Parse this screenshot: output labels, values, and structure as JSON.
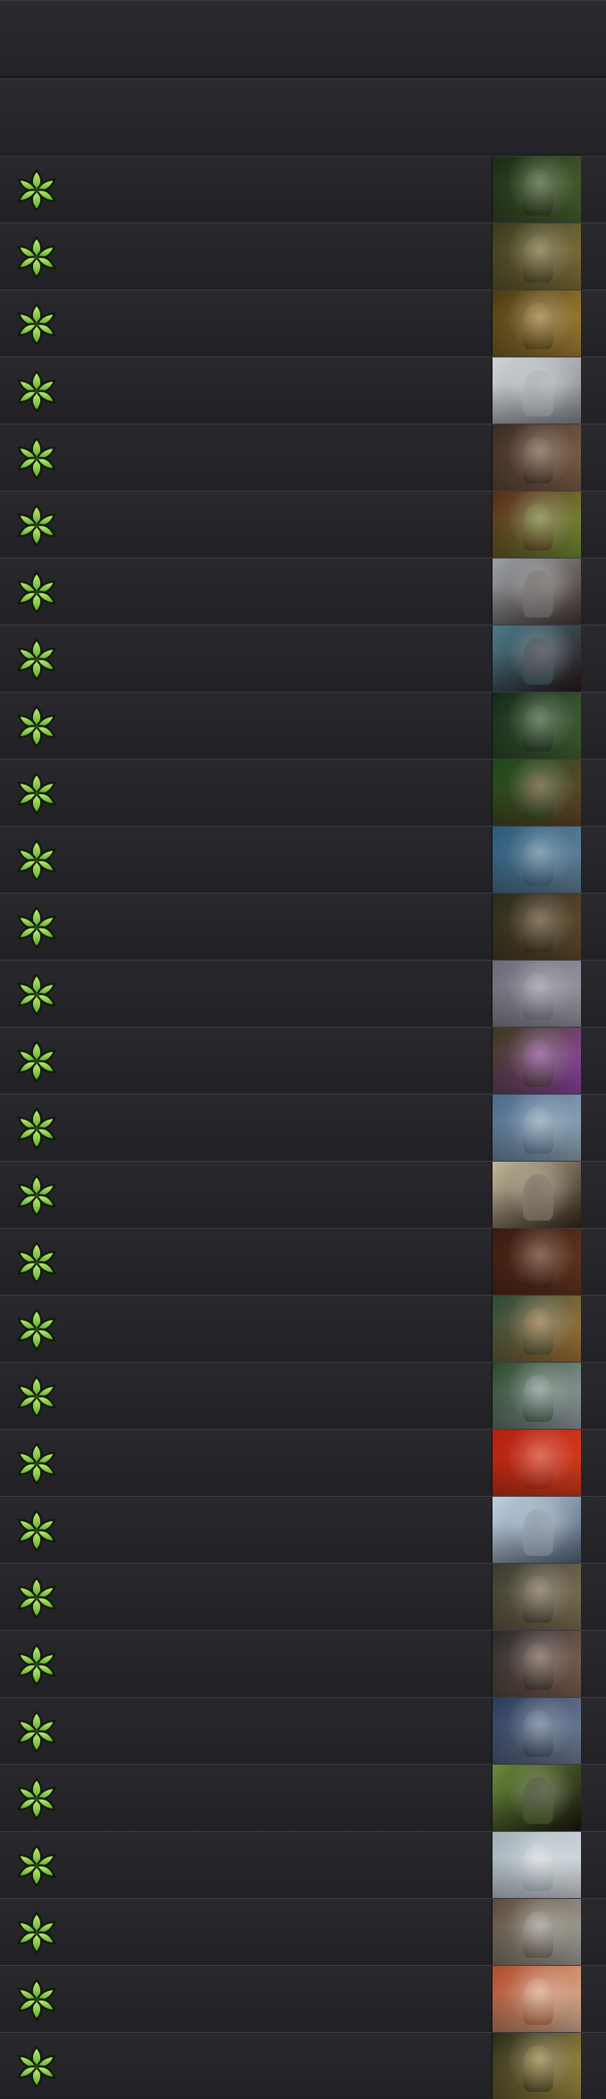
{
  "header": {
    "title": "",
    "subtitle": ""
  },
  "faction_icon": "green-leaf-star-icon",
  "cards": [
    {
      "art_colors": [
        "#1c2a14",
        "#4f6a32"
      ]
    },
    {
      "art_colors": [
        "#3a3a1e",
        "#8a7a40"
      ]
    },
    {
      "art_colors": [
        "#4a3a12",
        "#b08a3a"
      ]
    },
    {
      "art_colors": [
        "#cfd3d6",
        "#8a8f96"
      ]
    },
    {
      "art_colors": [
        "#3a2a22",
        "#8a6a50"
      ]
    },
    {
      "art_colors": [
        "#5a2a1a",
        "#7a9a3a"
      ]
    },
    {
      "art_colors": [
        "#9aa0a6",
        "#4a3a34"
      ]
    },
    {
      "art_colors": [
        "#4a7a8a",
        "#2a1a1a"
      ]
    },
    {
      "art_colors": [
        "#142a1a",
        "#4a6a3a"
      ]
    },
    {
      "art_colors": [
        "#1a4a1a",
        "#6a4a2a"
      ]
    },
    {
      "art_colors": [
        "#2a5a7a",
        "#6a8aa0"
      ]
    },
    {
      "art_colors": [
        "#2a2a1a",
        "#6a5030"
      ]
    },
    {
      "art_colors": [
        "#6a6a78",
        "#a0a0aa"
      ]
    },
    {
      "art_colors": [
        "#3a3a1a",
        "#9a4ab0"
      ]
    },
    {
      "art_colors": [
        "#4a6a8a",
        "#9ab0c0"
      ]
    },
    {
      "art_colors": [
        "#c0b89a",
        "#3a2a20"
      ]
    },
    {
      "art_colors": [
        "#3a1a10",
        "#6a3a20"
      ]
    },
    {
      "art_colors": [
        "#2a4a3a",
        "#b07a3a"
      ]
    },
    {
      "art_colors": [
        "#2a4a2a",
        "#a0a8b0"
      ]
    },
    {
      "art_colors": [
        "#b02010",
        "#e04020"
      ]
    },
    {
      "art_colors": [
        "#c0d0e0",
        "#5a6a80"
      ]
    },
    {
      "art_colors": [
        "#3a3a30",
        "#8a7a5a"
      ]
    },
    {
      "art_colors": [
        "#2a2a2a",
        "#8a6a5a"
      ]
    },
    {
      "art_colors": [
        "#2a3a5a",
        "#7a8aa0"
      ]
    },
    {
      "art_colors": [
        "#6a8a3a",
        "#1a1a10"
      ]
    },
    {
      "art_colors": [
        "#a0b0b8",
        "#e0e4e8"
      ]
    },
    {
      "art_colors": [
        "#5a4a3a",
        "#b0b0a8"
      ]
    },
    {
      "art_colors": [
        "#b04a2a",
        "#e0c0a0"
      ]
    },
    {
      "art_colors": [
        "#2a2a1a",
        "#b09a4a"
      ]
    }
  ]
}
